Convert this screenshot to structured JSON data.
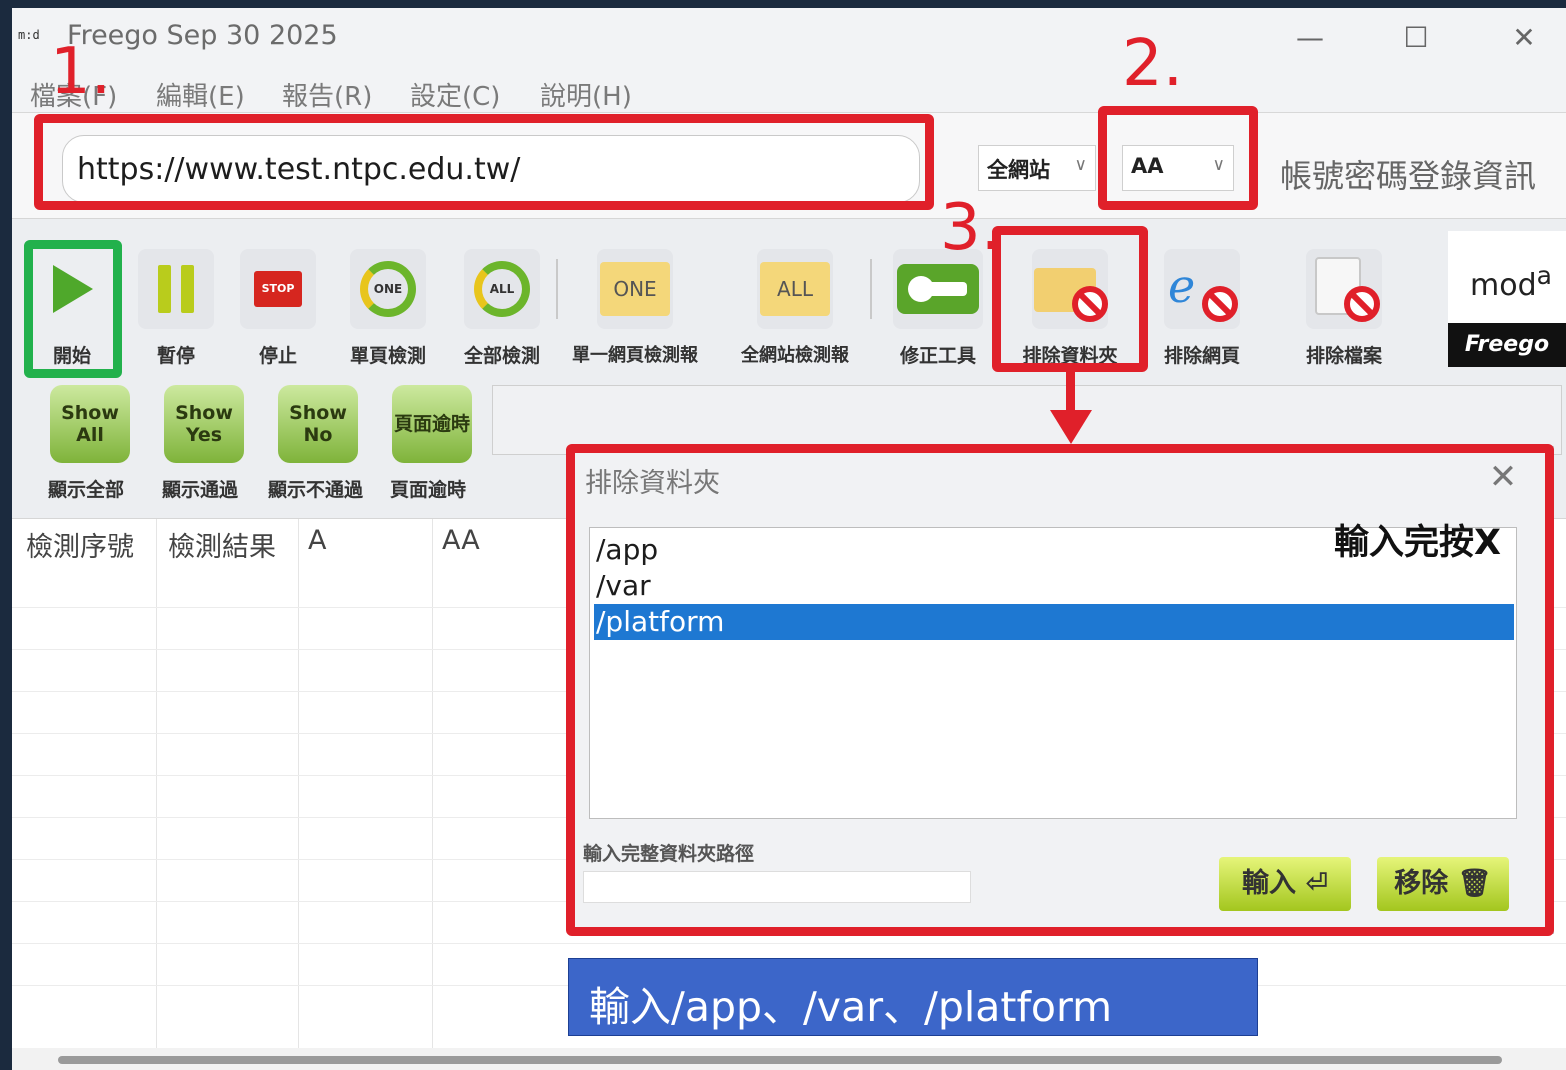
{
  "window": {
    "logo_text": "m:d",
    "title": "Freego Sep 30 2025",
    "controls": {
      "minimize": "—",
      "maximize": "☐",
      "close": "✕"
    }
  },
  "menu": [
    "檔案(F)",
    "編輯(E)",
    "報告(R)",
    "設定(C)",
    "說明(H)"
  ],
  "url_bar": {
    "url": "https://www.test.ntpc.edu.tw/",
    "scope": "全網站",
    "account": "AA",
    "login_label": "帳號密碼登錄資訊"
  },
  "toolbar": [
    {
      "label": "開始",
      "icon": "play-icon"
    },
    {
      "label": "暫停",
      "icon": "pause-icon"
    },
    {
      "label": "停止",
      "icon": "stop-icon",
      "text": "STOP"
    },
    {
      "label": "單頁檢測",
      "icon": "refresh-one-icon",
      "text": "ONE"
    },
    {
      "label": "全部檢測",
      "icon": "refresh-all-icon",
      "text": "ALL"
    },
    {
      "label": "單一網頁檢測報",
      "icon": "folder-one-icon",
      "text": "ONE"
    },
    {
      "label": "全網站檢測報",
      "icon": "folder-all-icon",
      "text": "ALL"
    },
    {
      "label": "修正工具",
      "icon": "wrench-icon"
    },
    {
      "label": "排除資料夾",
      "icon": "exclude-folder-icon"
    },
    {
      "label": "排除網頁",
      "icon": "exclude-page-icon"
    },
    {
      "label": "排除檔案",
      "icon": "exclude-file-icon"
    }
  ],
  "brand": {
    "logo_text": "mod",
    "logo_sup": "a",
    "product": "Freego"
  },
  "filters": [
    {
      "button": "Show All",
      "label": "顯示全部"
    },
    {
      "button": "Show Yes",
      "label": "顯示通過"
    },
    {
      "button": "Show No",
      "label": "顯示不通過"
    },
    {
      "button": "頁面逾時",
      "label": "頁面逾時"
    }
  ],
  "table": {
    "headers": [
      "檢測序號",
      "檢測結果",
      "A",
      "AA"
    ]
  },
  "dialog": {
    "title": "排除資料夾",
    "close": "✕",
    "items": [
      "/app",
      "/var",
      "/platform"
    ],
    "selected_index": 2,
    "input_hint": "輸入完整資料夾路徑",
    "input_value": "",
    "input_button": "輸入 ⏎",
    "remove_button": "移除 🗑"
  },
  "annotations": {
    "step1": "1.",
    "step2": "2.",
    "step3": "3.",
    "note": "輸入完按X",
    "caption": "輸入/app、/var、/platform",
    "red": "#e0202a",
    "green": "#22b14c"
  }
}
